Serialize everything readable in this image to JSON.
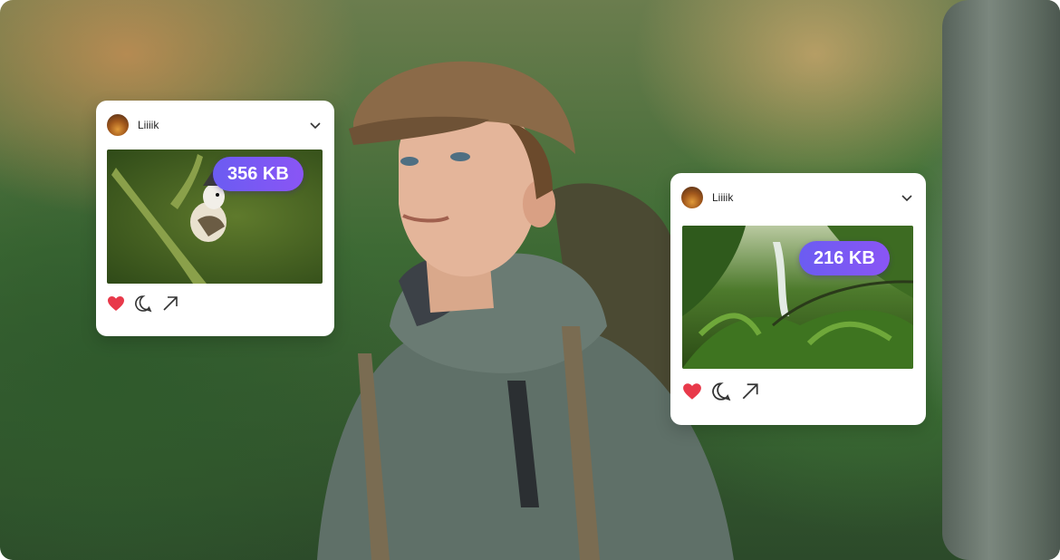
{
  "posts": [
    {
      "username": "Liiiik",
      "size_label": "356 KB",
      "photo_icon": "bird-on-branch-photo",
      "liked": true
    },
    {
      "username": "Liiiik",
      "size_label": "216 KB",
      "photo_icon": "jungle-waterfall-photo",
      "liked": true
    }
  ],
  "colors": {
    "badge_start": "#6b5cf2",
    "badge_end": "#8a55f5",
    "heart": "#e8394a",
    "card_bg": "#ffffff"
  },
  "icons": {
    "like": "heart-icon",
    "comment": "comment-icon",
    "share": "share-arrow-icon",
    "menu": "chevron-down-icon"
  }
}
